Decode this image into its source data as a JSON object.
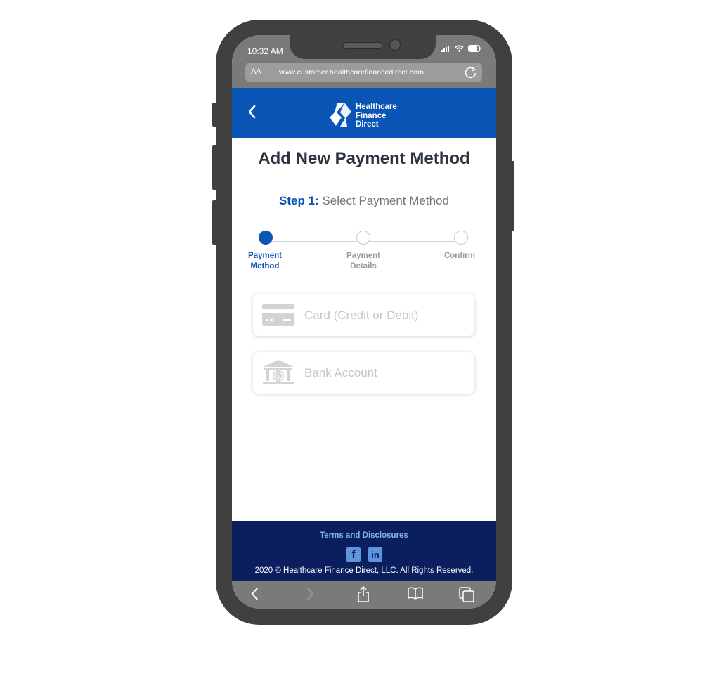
{
  "status_bar": {
    "time": "10:32 AM"
  },
  "browser": {
    "text_size_label": "AA",
    "url": "www.customer.healthcarefinancedirect.com"
  },
  "header": {
    "logo_text": [
      "Healthcare",
      "Finance",
      "Direct"
    ]
  },
  "main": {
    "title": "Add New Payment Method",
    "step_prefix": "Step 1:",
    "step_text": "Select Payment Method",
    "steps": [
      {
        "line1": "Payment",
        "line2": "Method",
        "state": "active"
      },
      {
        "line1": "Payment",
        "line2": "Details",
        "state": "inactive"
      },
      {
        "line1": "Confirm",
        "line2": "",
        "state": "inactive"
      }
    ],
    "options": [
      {
        "label": "Card (Credit or Debit)",
        "icon": "credit-card-icon"
      },
      {
        "label": "Bank Account",
        "icon": "bank-icon"
      }
    ]
  },
  "footer": {
    "terms_label": "Terms and Disclosures",
    "social": [
      {
        "name": "facebook-icon",
        "glyph": "f"
      },
      {
        "name": "linkedin-icon",
        "glyph": "in"
      }
    ],
    "copyright": "2020 © Healthcare Finance Direct, LLC. All Rights Reserved."
  },
  "colors": {
    "brand_blue": "#0a55b5",
    "footer_navy": "#0b1f5e",
    "link_blue": "#7fb1f2",
    "muted_text": "#6f7780"
  }
}
